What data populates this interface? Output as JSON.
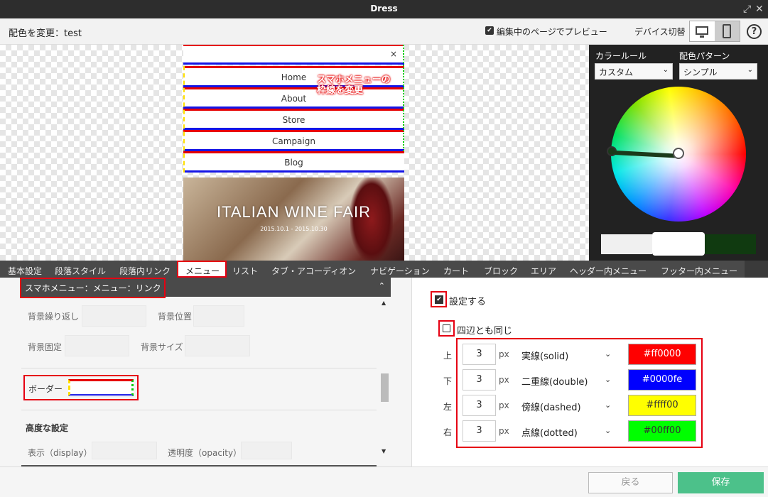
{
  "window": {
    "title": "Dress"
  },
  "header": {
    "title": "配色を変更：test",
    "preview_label": "編集中のページでプレビュー",
    "device_label": "デバイス切替",
    "help": "?"
  },
  "preview": {
    "annotation_line1": "スマホメニューの",
    "annotation_line2": "枠線を変更",
    "close": "×",
    "nav_items": [
      "Home",
      "About",
      "Store",
      "Campaign",
      "Blog"
    ],
    "banner_title": "ITALIAN WINE FAIR",
    "banner_date": "2015.10.1 - 2015.10.30"
  },
  "color_panel": {
    "rule_label": "カラールール",
    "rule_value": "カスタム",
    "pattern_label": "配色パターン",
    "pattern_value": "シンプル",
    "swatches": [
      "#f0f0f0",
      "#ffffff",
      "#103a10"
    ]
  },
  "tabs": [
    "基本設定",
    "段落スタイル",
    "段落内リンク",
    "メニュー",
    "リスト",
    "タブ・アコーディオン",
    "ナビゲーション",
    "カート",
    "ブロック",
    "エリア",
    "ヘッダー内メニュー",
    "フッター内メニュー"
  ],
  "left_panel": {
    "section_title": "スマホメニュー：メニュー：リンク",
    "bg_repeat": "背景繰り返し",
    "bg_position": "背景位置",
    "bg_fixed": "背景固定",
    "bg_size": "背景サイズ",
    "border_label": "ボーダー",
    "advanced_title": "高度な設定",
    "display_label": "表示（display）",
    "opacity_label": "透明度（opacity）"
  },
  "right_panel": {
    "enable_label": "設定する",
    "enable_checked": true,
    "same_label": "四辺とも同じ",
    "same_checked": false,
    "unit": "px",
    "rows": [
      {
        "side": "上",
        "width": "3",
        "style": "実線(solid)",
        "color": "#ff0000",
        "text_color": "#ffffff"
      },
      {
        "side": "下",
        "width": "3",
        "style": "二重線(double)",
        "color": "#0000fe",
        "text_color": "#ffffff"
      },
      {
        "side": "左",
        "width": "3",
        "style": "傍線(dashed)",
        "color": "#ffff00",
        "text_color": "#333333"
      },
      {
        "side": "右",
        "width": "3",
        "style": "点線(dotted)",
        "color": "#00ff00",
        "text_color": "#333333"
      }
    ]
  },
  "footer": {
    "back_label": "戻る",
    "save_label": "保存"
  }
}
